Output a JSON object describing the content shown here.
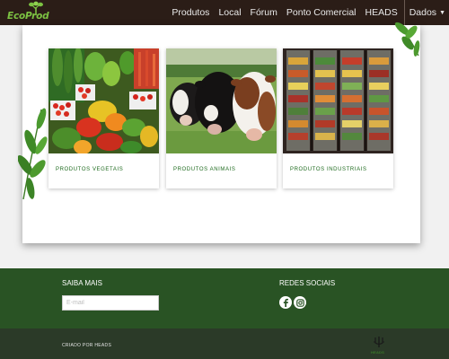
{
  "navbar": {
    "logo_text": "EcoProd",
    "links": [
      "Produtos",
      "Local",
      "Fórum",
      "Ponto Comercial",
      "HEADS"
    ],
    "dropdown_label": "Dados"
  },
  "products": [
    {
      "caption": "PRODUTOS VEGETAIS",
      "icon": "vegetables-image"
    },
    {
      "caption": "PRODUTOS ANIMAIS",
      "icon": "cows-image"
    },
    {
      "caption": "PRODUTOS INDUSTRIAIS",
      "icon": "supermarket-shelves-image"
    }
  ],
  "footer": {
    "learn_more_title": "SAIBA MAIS",
    "email_placeholder": "E-mail",
    "social_title": "REDES SOCIAIS",
    "social_icons": [
      "facebook-icon",
      "instagram-icon"
    ]
  },
  "bottom": {
    "credit": "CRIADO POR HEADS",
    "logo_text": "HEADS"
  },
  "colors": {
    "navbar": "#2b1d17",
    "footer": "#295324",
    "bottom_bar": "#2b3a28",
    "caption": "#1f6b1f",
    "logo_green": "#7cc242"
  }
}
